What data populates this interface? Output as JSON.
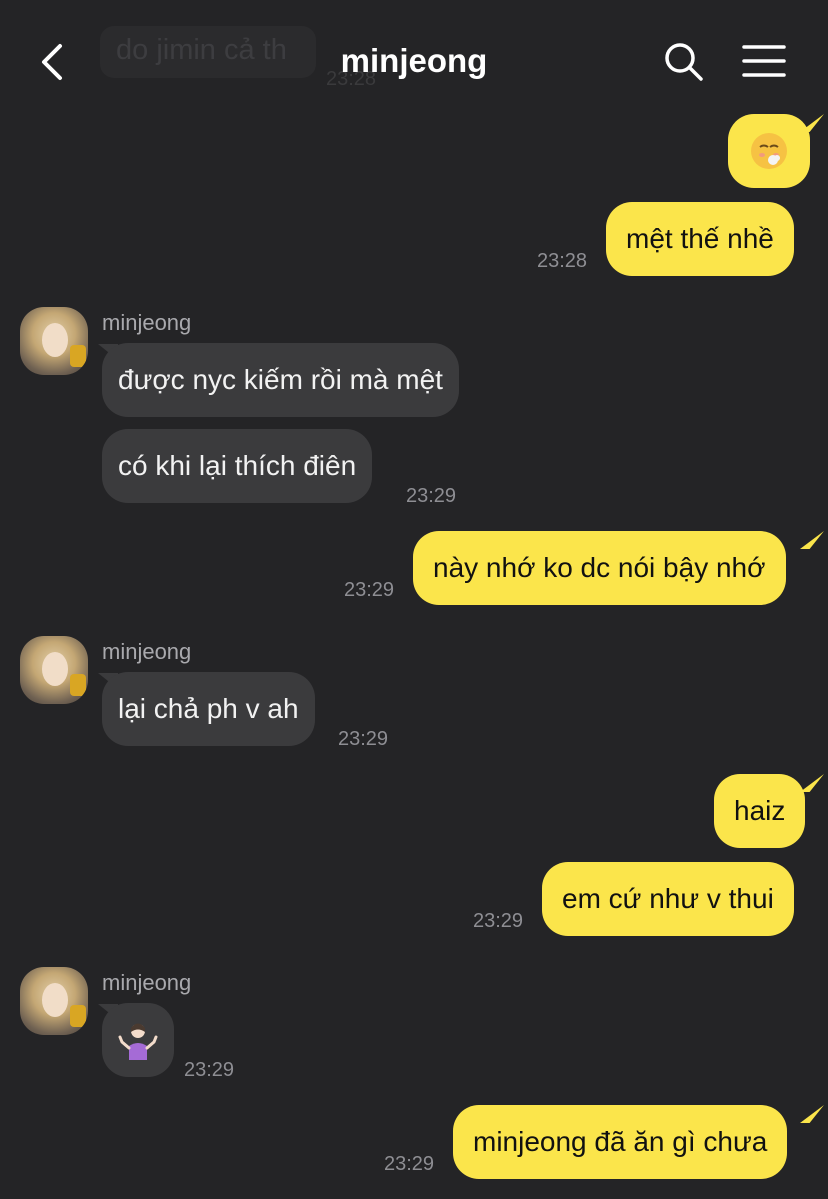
{
  "header": {
    "title": "minjeong",
    "peek_text": "do jimin cả th",
    "peek_time": "23:28"
  },
  "messages": {
    "m1": {
      "emoji_name": "exhausted-face-emoji"
    },
    "m2": {
      "text": "mệt thế nhề",
      "time": "23:28"
    },
    "g1": {
      "sender": "minjeong"
    },
    "m3": {
      "text": "được nyc kiếm rồi mà mệt"
    },
    "m4": {
      "text": "có khi lại thích điên",
      "time": "23:29"
    },
    "m5": {
      "text": "này nhớ ko dc nói bậy nhớ",
      "time": "23:29"
    },
    "g2": {
      "sender": "minjeong"
    },
    "m6": {
      "text": "lại chả ph v ah",
      "time": "23:29"
    },
    "m7": {
      "text": "haiz"
    },
    "m8": {
      "text": "em cứ như v thui",
      "time": "23:29"
    },
    "g3": {
      "sender": "minjeong"
    },
    "m9": {
      "emoji_name": "person-shrugging-emoji",
      "time": "23:29"
    },
    "m10": {
      "text": "minjeong đã ăn gì chưa",
      "time": "23:29"
    }
  },
  "colors": {
    "background": "#242426",
    "my_bubble": "#fbe54b",
    "their_bubble": "#3b3b3d",
    "timestamp": "#8e8e93"
  }
}
